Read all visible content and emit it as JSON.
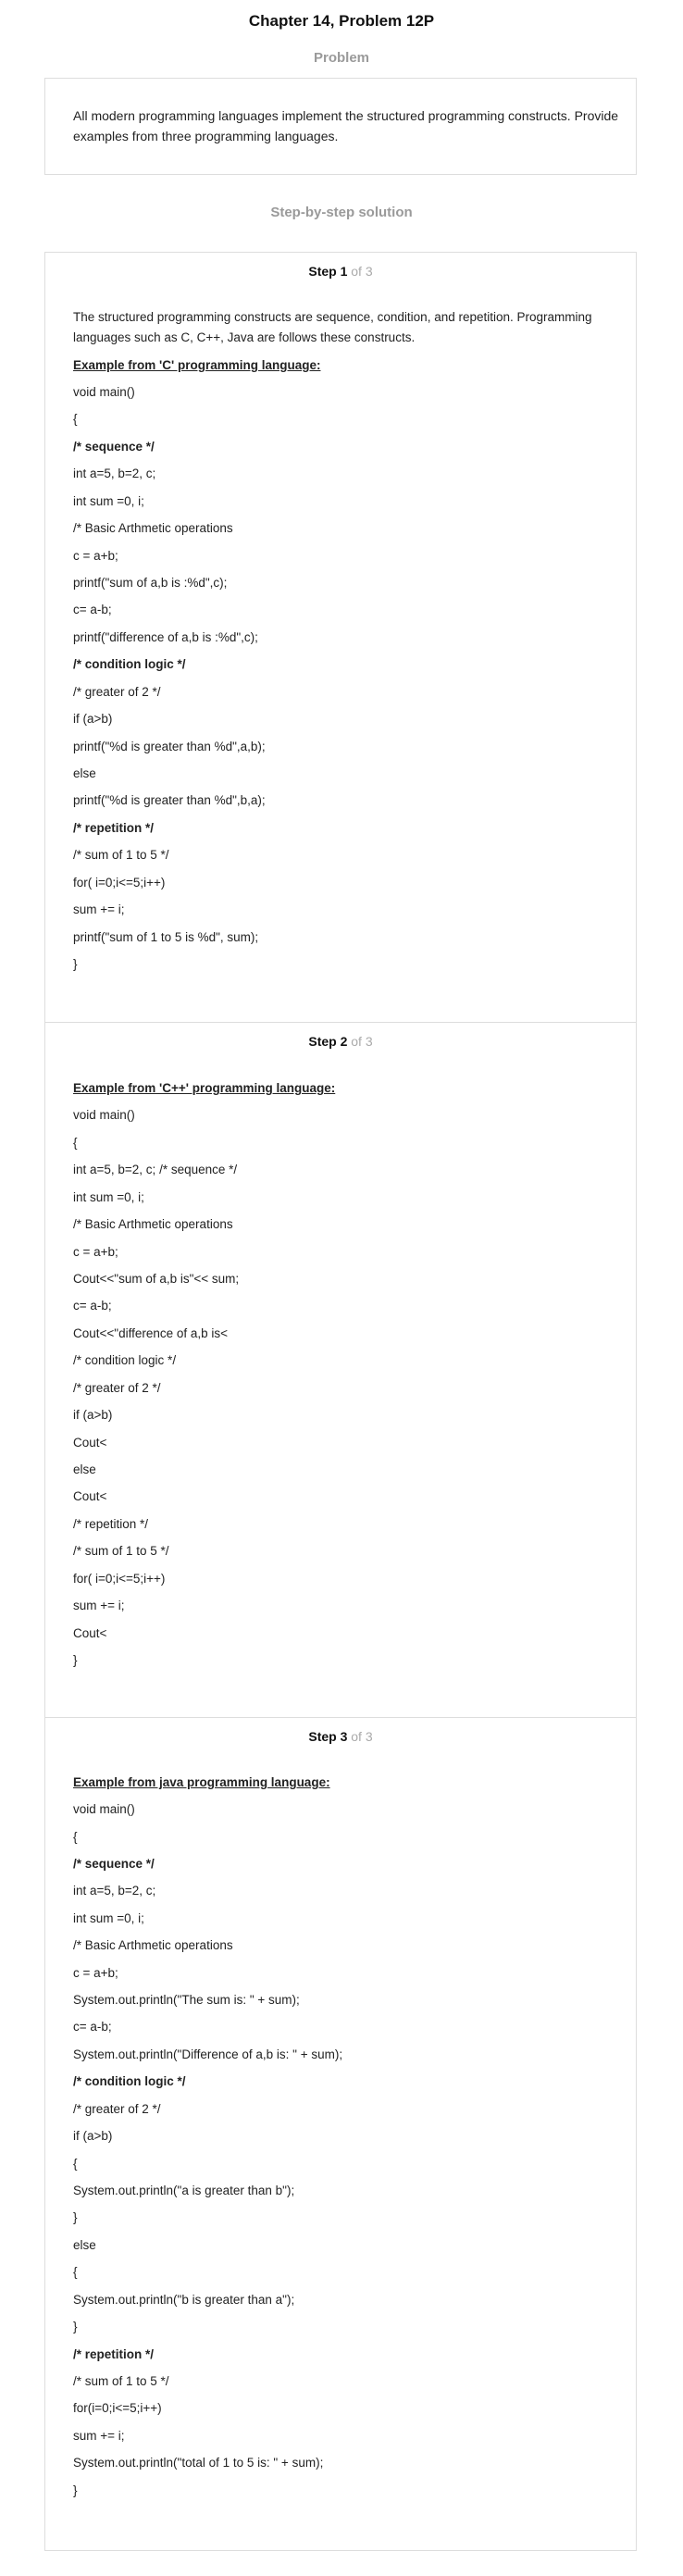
{
  "page_title": "Chapter 14, Problem 12P",
  "problem": {
    "heading": "Problem",
    "text": "All modern programming languages implement the structured programming constructs. Provide examples from three programming languages."
  },
  "solution": {
    "heading": "Step-by-step solution",
    "steps": [
      {
        "label": "Step 1",
        "of": "of 3",
        "intro": "The structured programming constructs are sequence, condition, and repetition. Programming languages such as C, C++, Java are follows these constructs.",
        "example_title": "Example from 'C' programming language:",
        "lines": [
          {
            "text": "void main()",
            "bold": false
          },
          {
            "text": "{",
            "bold": false
          },
          {
            "text": "/* sequence */",
            "bold": true
          },
          {
            "text": "int a=5, b=2, c;",
            "bold": false
          },
          {
            "text": "int sum =0, i;",
            "bold": false
          },
          {
            "text": "/* Basic Arthmetic operations",
            "bold": false
          },
          {
            "text": "c = a+b;",
            "bold": false
          },
          {
            "text": "printf(\"sum of a,b is :%d\",c);",
            "bold": false
          },
          {
            "text": "c= a-b;",
            "bold": false
          },
          {
            "text": "printf(\"difference of a,b is :%d\",c);",
            "bold": false
          },
          {
            "text": "/* condition logic */",
            "bold": true
          },
          {
            "text": "/* greater of 2 */",
            "bold": false
          },
          {
            "text": "if (a>b)",
            "bold": false
          },
          {
            "text": "printf(\"%d is greater than %d\",a,b);",
            "bold": false
          },
          {
            "text": "else",
            "bold": false
          },
          {
            "text": "printf(\"%d is greater than %d\",b,a);",
            "bold": false
          },
          {
            "text": "/* repetition */",
            "bold": true
          },
          {
            "text": "/* sum of 1 to 5 */",
            "bold": false
          },
          {
            "text": "for( i=0;i<=5;i++)",
            "bold": false
          },
          {
            "text": "sum += i;",
            "bold": false
          },
          {
            "text": "printf(\"sum of 1 to 5 is %d\", sum);",
            "bold": false
          },
          {
            "text": "}",
            "bold": false
          }
        ]
      },
      {
        "label": "Step 2",
        "of": "of 3",
        "example_title": "Example from 'C++' programming language:",
        "lines": [
          {
            "text": "void main()",
            "bold": false
          },
          {
            "text": "{",
            "bold": false
          },
          {
            "text": "int a=5, b=2, c; /* sequence */",
            "bold": false
          },
          {
            "text": "int sum =0, i;",
            "bold": false
          },
          {
            "text": "/* Basic Arthmetic operations",
            "bold": false
          },
          {
            "text": "c = a+b;",
            "bold": false
          },
          {
            "text": "Cout<<\"sum of a,b is\"<< sum;",
            "bold": false
          },
          {
            "text": "c= a-b;",
            "bold": false
          },
          {
            "text": "Cout<<\"difference of a,b is<",
            "bold": false
          },
          {
            "text": "/* condition logic */",
            "bold": false
          },
          {
            "text": "/* greater of 2 */",
            "bold": false
          },
          {
            "text": "if (a>b)",
            "bold": false
          },
          {
            "text": "Cout<",
            "bold": false
          },
          {
            "text": "else",
            "bold": false
          },
          {
            "text": "Cout<",
            "bold": false
          },
          {
            "text": "/* repetition */",
            "bold": false
          },
          {
            "text": "/* sum of 1 to 5 */",
            "bold": false
          },
          {
            "text": "for( i=0;i<=5;i++)",
            "bold": false
          },
          {
            "text": "sum += i;",
            "bold": false
          },
          {
            "text": "Cout<",
            "bold": false
          },
          {
            "text": "}",
            "bold": false
          }
        ]
      },
      {
        "label": "Step 3",
        "of": "of 3",
        "example_title": "Example from java programming language:",
        "lines": [
          {
            "text": "void main()",
            "bold": false
          },
          {
            "text": "{",
            "bold": false
          },
          {
            "text": "/* sequence */",
            "bold": true
          },
          {
            "text": "int a=5, b=2, c;",
            "bold": false
          },
          {
            "text": "int sum =0, i;",
            "bold": false
          },
          {
            "text": "/* Basic Arthmetic operations",
            "bold": false
          },
          {
            "text": "c = a+b;",
            "bold": false
          },
          {
            "text": "System.out.println(\"The sum is: \" + sum);",
            "bold": false
          },
          {
            "text": "c= a-b;",
            "bold": false
          },
          {
            "text": "System.out.println(\"Difference of a,b is: \" + sum);",
            "bold": false
          },
          {
            "text": "/* condition logic */",
            "bold": true
          },
          {
            "text": "/* greater of 2 */",
            "bold": false
          },
          {
            "text": "if (a>b)",
            "bold": false
          },
          {
            "text": "{",
            "bold": false
          },
          {
            "text": "System.out.println(\"a is greater than b\");",
            "bold": false
          },
          {
            "text": "}",
            "bold": false
          },
          {
            "text": "else",
            "bold": false
          },
          {
            "text": "{",
            "bold": false
          },
          {
            "text": "System.out.println(\"b is greater than a\");",
            "bold": false
          },
          {
            "text": "}",
            "bold": false
          },
          {
            "text": "/* repetition */",
            "bold": true
          },
          {
            "text": "/* sum of 1 to 5 */",
            "bold": false
          },
          {
            "text": "for(i=0;i<=5;i++)",
            "bold": false
          },
          {
            "text": "sum += i;",
            "bold": false
          },
          {
            "text": "System.out.println(\"total of 1 to 5 is: \" + sum);",
            "bold": false
          },
          {
            "text": "}",
            "bold": false
          }
        ]
      }
    ]
  }
}
